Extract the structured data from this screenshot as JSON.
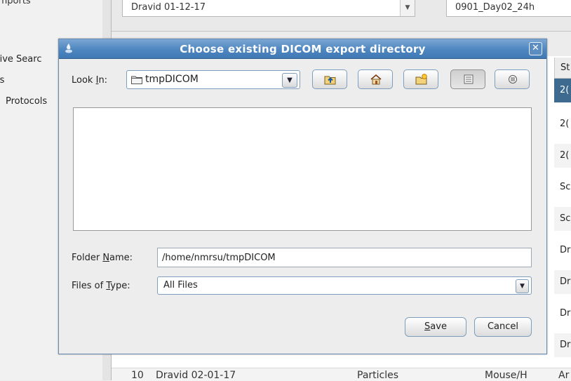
{
  "background": {
    "left_panel_items": [
      "iive Searc",
      "ıs",
      "Protocols"
    ],
    "top_cut_text": "ımports",
    "combo_left_value": "Dravid 01-12-17",
    "combo_right_value": "0901_Day02_24h",
    "table_header_partial": "St",
    "table_cells_partial": [
      "2(",
      "2(",
      "2(",
      "Sc",
      "Sc",
      "Dr",
      "Dr",
      "Dr",
      "Dr"
    ],
    "row10": {
      "index": "10",
      "name": "Dravid 02-01-17",
      "type": "Particles",
      "species": "Mouse/H",
      "last": "Ar"
    }
  },
  "dialog": {
    "title": "Choose existing DICOM export directory",
    "look_in": {
      "label_pre": "Look ",
      "label_mnemonic": "I",
      "label_post": "n:",
      "value": "tmpDICOM"
    },
    "toolbar": {
      "icons": [
        "up-one-level-icon",
        "home-icon",
        "new-folder-icon",
        "list-view-icon",
        "details-view-icon"
      ]
    },
    "folder_name": {
      "label_pre": "Folder ",
      "label_mnemonic": "N",
      "label_post": "ame:",
      "value": "/home/nmrsu/tmpDICOM"
    },
    "files_of_type": {
      "label_pre": "Files of ",
      "label_mnemonic": "T",
      "label_post": "ype:",
      "value": "All Files"
    },
    "buttons": {
      "save_mnemonic": "S",
      "save_rest": "ave",
      "cancel": "Cancel"
    }
  },
  "colors": {
    "titlebar": "#4e86c0",
    "selection": "#3d6a8e",
    "button_border": "#7f9dbd"
  }
}
